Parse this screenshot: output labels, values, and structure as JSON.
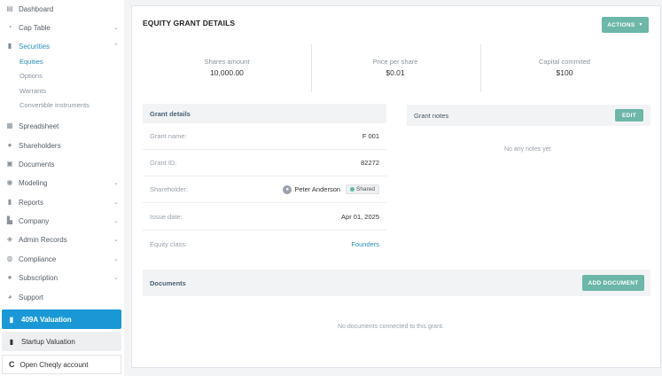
{
  "sidebar": {
    "items": [
      {
        "label": "Dashboard",
        "icon": "dashboard-icon"
      },
      {
        "label": "Cap Table",
        "icon": "pie-chart-icon"
      },
      {
        "label": "Securities",
        "icon": "document-icon"
      },
      {
        "label": "Spreadsheet",
        "icon": "grid-icon"
      },
      {
        "label": "Shareholders",
        "icon": "person-icon"
      },
      {
        "label": "Documents",
        "icon": "folder-icon"
      },
      {
        "label": "Modeling",
        "icon": "bulb-icon"
      },
      {
        "label": "Reports",
        "icon": "report-icon"
      },
      {
        "label": "Company",
        "icon": "building-icon"
      },
      {
        "label": "Admin Records",
        "icon": "archive-icon"
      },
      {
        "label": "Compliance",
        "icon": "shield-icon"
      },
      {
        "label": "Subscription",
        "icon": "coin-icon"
      },
      {
        "label": "Support",
        "icon": "chat-icon"
      }
    ],
    "securities_sub": [
      "Equities",
      "Options",
      "Warrants",
      "Convertible instruments"
    ],
    "valuation_409a": "409A Valuation",
    "startup_valuation": "Startup Valuation",
    "open_account": "Open Cheqly account"
  },
  "main": {
    "title": "EQUITY GRANT DETAILS",
    "actions_label": "ACTIONS",
    "stats": [
      {
        "label": "Shares amount",
        "value": "10,000.00"
      },
      {
        "label": "Price per share",
        "value": "$0.01"
      },
      {
        "label": "Capital commited",
        "value": "$100"
      }
    ],
    "grant_details": {
      "header": "Grant details",
      "rows": [
        {
          "key": "Grant name:",
          "value": "F 001"
        },
        {
          "key": "Grant ID:",
          "value": "82272"
        },
        {
          "key": "Shareholder:",
          "value": "Peter Anderson",
          "badge": "Shared"
        },
        {
          "key": "Issue date:",
          "value": "Apr 01, 2025"
        },
        {
          "key": "Equity class:",
          "value": "Founders"
        }
      ]
    },
    "grant_notes": {
      "header": "Grant notes",
      "edit_label": "EDIT",
      "empty": "No any notes yet"
    },
    "documents": {
      "header": "Documents",
      "add_label": "ADD DOCUMENT",
      "empty": "No documents connected to this grant."
    }
  },
  "colors": {
    "accent_teal": "#6cb7a8",
    "active_blue": "#1a98d5",
    "link_blue": "#2b8fc0"
  }
}
